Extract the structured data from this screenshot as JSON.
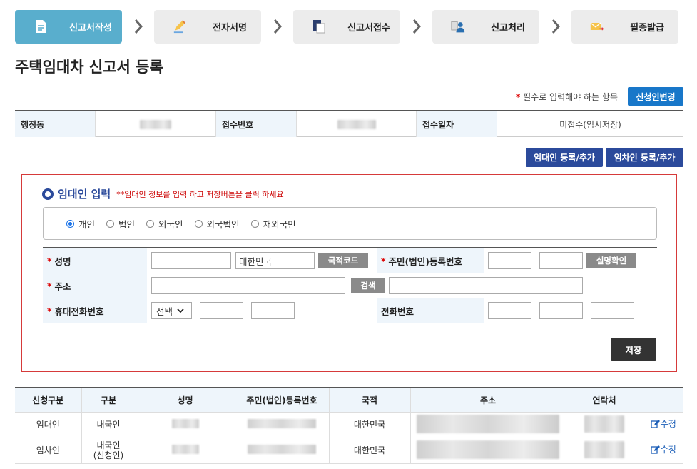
{
  "steps": [
    {
      "label": "신고서작성",
      "icon": "document-icon",
      "active": true
    },
    {
      "label": "전자서명",
      "icon": "pen-icon",
      "active": false
    },
    {
      "label": "신고서접수",
      "icon": "file-stack-icon",
      "active": false
    },
    {
      "label": "신고처리",
      "icon": "person-icon",
      "active": false
    },
    {
      "label": "필증발급",
      "icon": "envelope-icon",
      "active": false
    }
  ],
  "page_title": "주택임대차 신고서 등록",
  "required_note": {
    "star": "*",
    "text": "필수로 입력해야 하는 항목"
  },
  "buttons": {
    "change_applicant": "신청인변경",
    "add_lessor": "임대인 등록/추가",
    "add_lessee": "임차인 등록/추가",
    "save": "저장"
  },
  "info": {
    "dong_label": "행정동",
    "receipt_no_label": "접수번호",
    "receipt_date_label": "접수일자",
    "receipt_date_value": "미접수(임시저장)"
  },
  "lessor": {
    "title": "임대인 입력",
    "hint": "**임대인 정보를 입력 하고 저장버튼을 클릭 하세요",
    "types": [
      "개인",
      "법인",
      "외국인",
      "외국법인",
      "재외국민"
    ],
    "selected_type": "개인",
    "fields": {
      "name_label": "성명",
      "country_value": "대한민국",
      "country_code_btn": "국적코드",
      "reg_no_label": "주민(법인)등록번호",
      "verify_btn": "실명확인",
      "address_label": "주소",
      "search_btn": "검색",
      "mobile_label": "휴대전화번호",
      "mobile_select": "선택",
      "phone_label": "전화번호",
      "star": "*",
      "dash": "-"
    }
  },
  "list": {
    "headers": [
      "신청구분",
      "구분",
      "성명",
      "주민(법인)등록번호",
      "국적",
      "주소",
      "연락처",
      ""
    ],
    "rows": [
      {
        "type": "임대인",
        "kind": "내국인",
        "kind2": "",
        "country": "대한민국",
        "edit": "수정"
      },
      {
        "type": "임차인",
        "kind": "내국인",
        "kind2": "(신청인)",
        "country": "대한민국",
        "edit": "수정"
      }
    ]
  },
  "colors": {
    "active_step": "#59aecd",
    "primary": "#1877c9",
    "navy": "#2b4a9b",
    "alert_red": "#d63a3a"
  }
}
